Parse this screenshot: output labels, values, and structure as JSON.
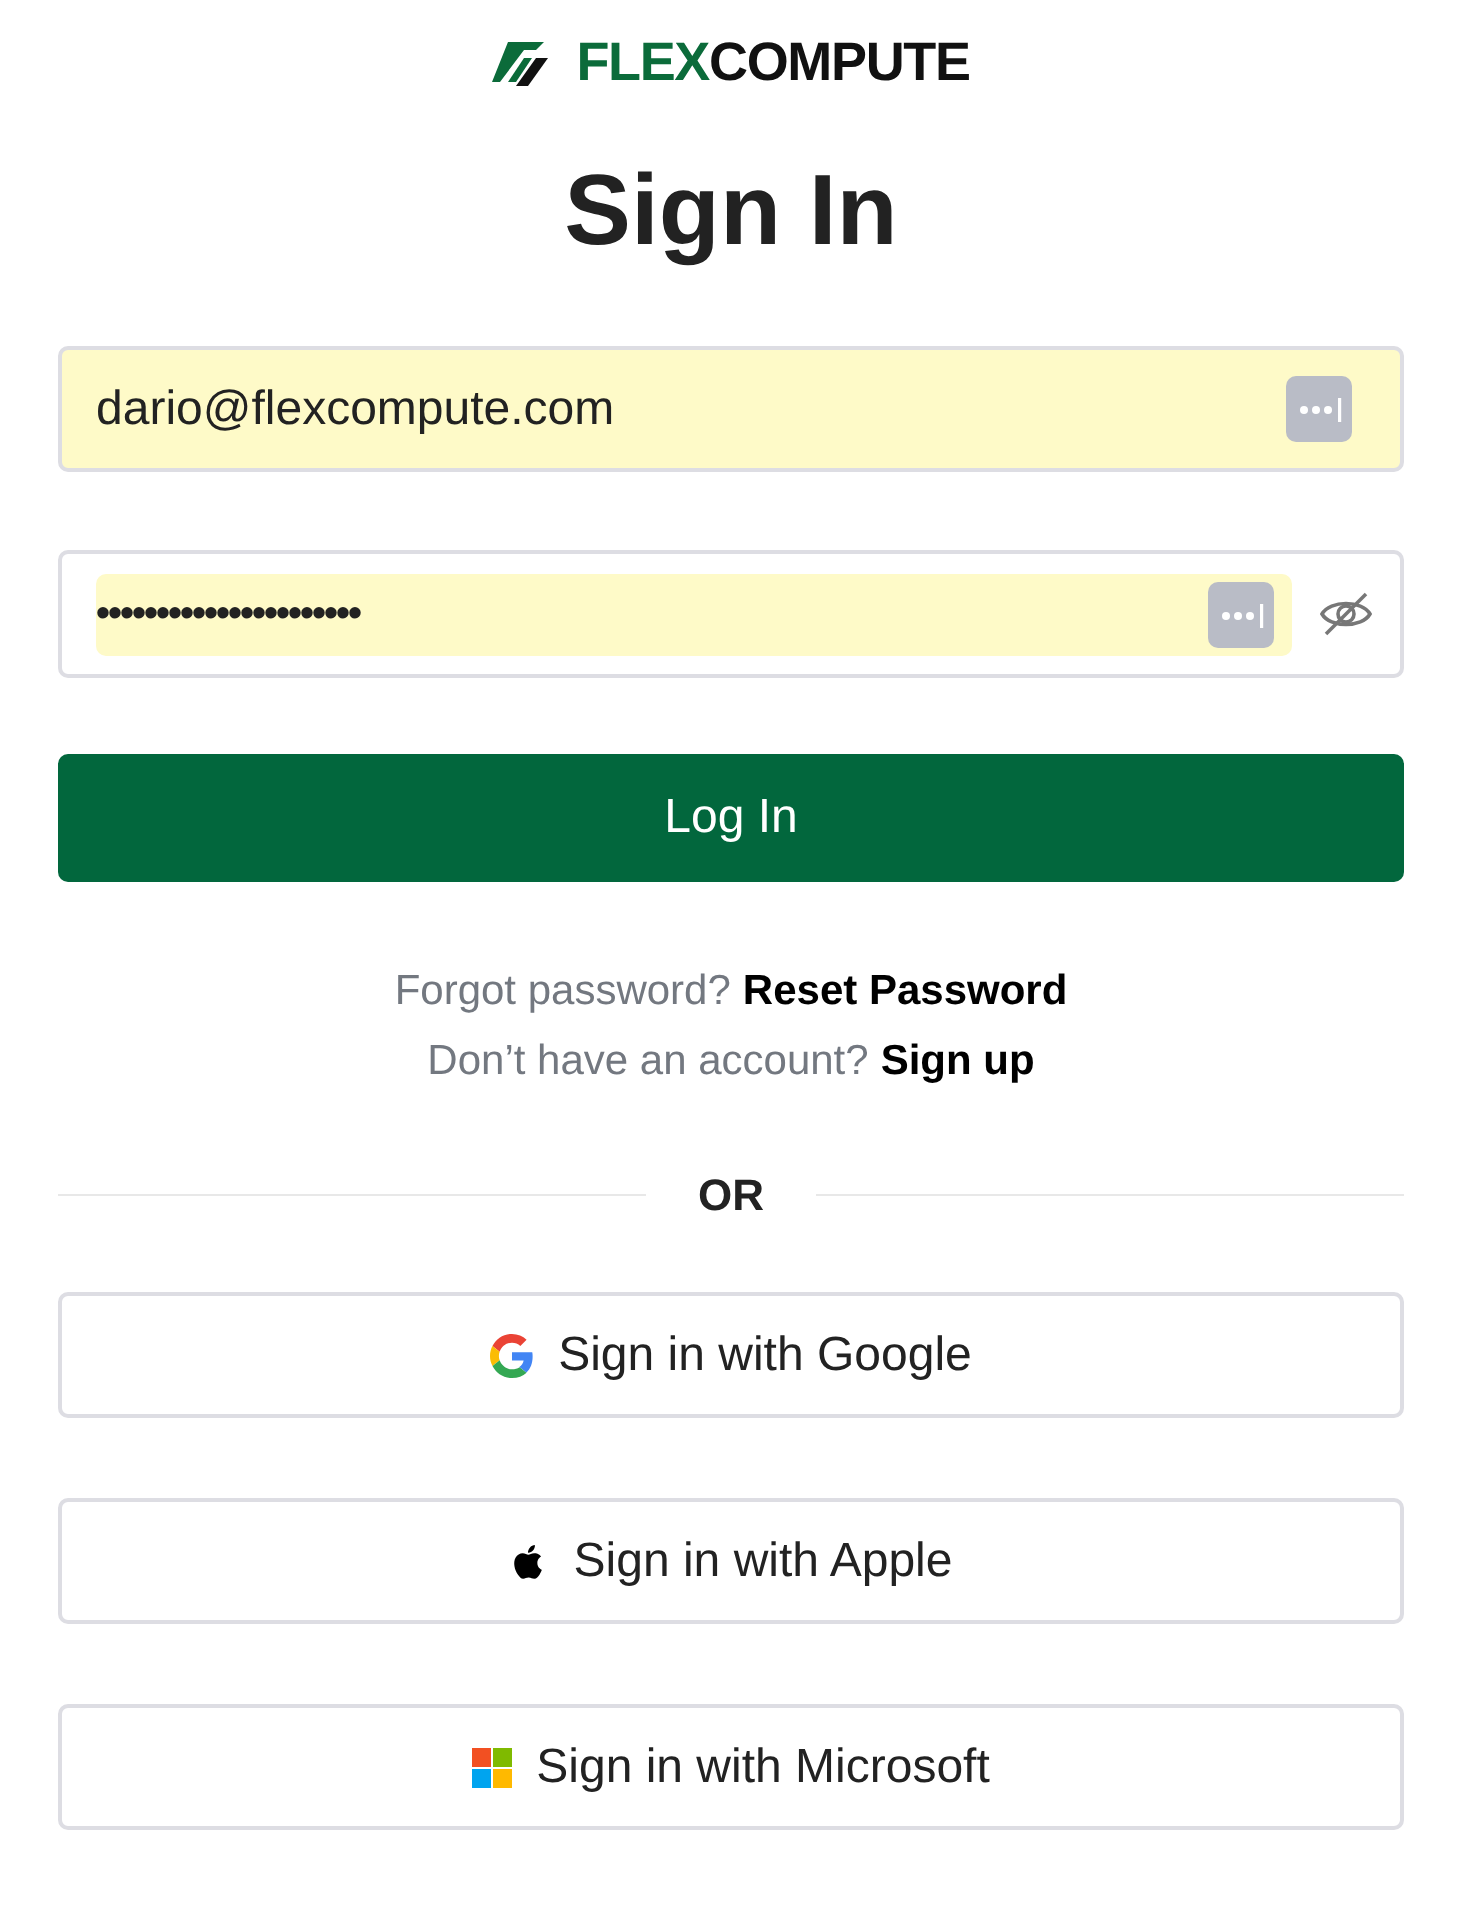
{
  "logo": {
    "part_1": "FLEX",
    "part_2": "COMPUTE"
  },
  "title": "Sign In",
  "email_field": {
    "value": "dario@flexcompute.com",
    "autofilled": true
  },
  "password_field": {
    "value": "••••••••••••••••••••••",
    "autofilled": true
  },
  "login_button": "Log In",
  "links": [
    {
      "prompt": "Forgot password?",
      "link": "Reset Password"
    },
    {
      "prompt": "Don’t have an account?",
      "link": "Sign up"
    }
  ],
  "divider": "OR",
  "social_buttons": [
    {
      "kind": "google",
      "label": "Sign in with Google"
    },
    {
      "kind": "apple",
      "label": "Sign in with Apple"
    },
    {
      "kind": "microsoft",
      "label": "Sign in with Microsoft"
    }
  ]
}
